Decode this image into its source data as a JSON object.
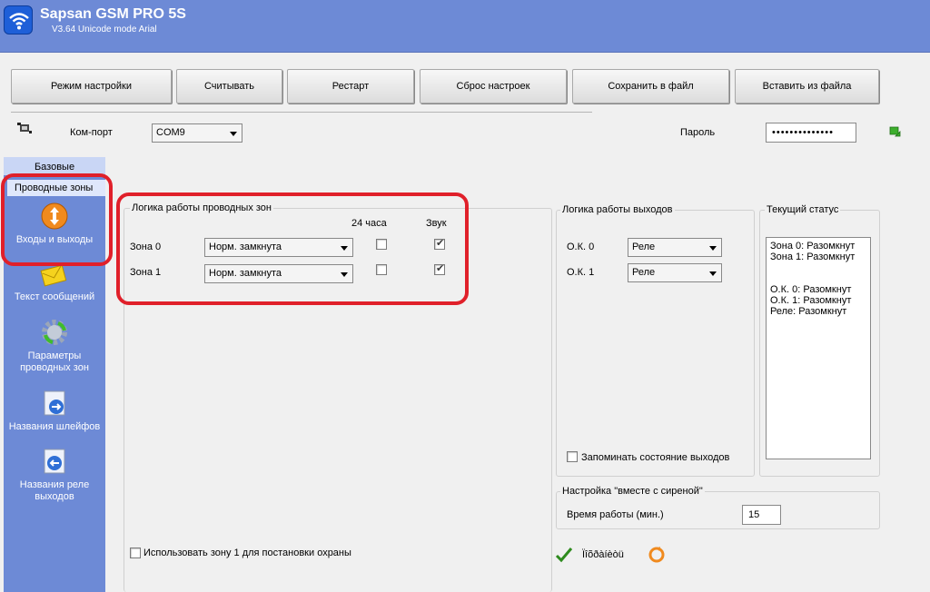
{
  "window": {
    "title": "Sapsan GSM PRO 5S",
    "subtitle": "V3.64 Unicode mode  Arial"
  },
  "toolbar": {
    "buttons": [
      "Режим настройки",
      "Считывать",
      "Рестарт",
      "Сброс настроек",
      "Сохранить в файл",
      "Вставить из файла"
    ]
  },
  "connection": {
    "port_label": "Ком-порт",
    "port_value": "COM9",
    "password_label": "Пароль",
    "password_value": "••••••••••••••"
  },
  "sidebar": {
    "tab_label": "Базовые",
    "selected_label": "Проводные зоны",
    "items": [
      "Входы и выходы",
      "Текст сообщений",
      "Параметры проводных зон",
      "Названия шлейфов",
      "Названия реле выходов"
    ]
  },
  "wired_zones": {
    "title": "Логика работы проводных зон",
    "col_24h": "24 часа",
    "col_sound": "Звук",
    "rows": [
      {
        "label": "Зона 0",
        "logic": "Норм. замкнута",
        "h24": false,
        "sound": true
      },
      {
        "label": "Зона 1",
        "logic": "Норм. замкнута",
        "h24": false,
        "sound": true
      }
    ],
    "use_zone1_label": "Использовать зону 1 для постановки охраны",
    "use_zone1_checked": false
  },
  "outputs": {
    "title": "Логика работы выходов",
    "rows": [
      {
        "label": "О.К. 0",
        "value": "Реле"
      },
      {
        "label": "О.К. 1",
        "value": "Реле"
      }
    ],
    "remember_label": "Запоминать состояние выходов",
    "remember_checked": false
  },
  "status": {
    "title": "Текущий статус",
    "lines": [
      "Зона 0: Разомкнут",
      "Зона 1: Разомкнут",
      "",
      "",
      "О.К. 0: Разомкнут",
      "О.К. 1: Разомкнут",
      "Реле: Разомкнут"
    ]
  },
  "siren": {
    "title": "Настройка \"вместе с сиреной\"",
    "time_label": "Время работы (мин.)",
    "time_value": "15"
  },
  "footer": {
    "apply_label": "Ïîõðàíèòü"
  },
  "colors": {
    "title_bar": "#6d8ad6",
    "sidebar": "#6d8ad6",
    "highlight_red": "#e0202a"
  }
}
